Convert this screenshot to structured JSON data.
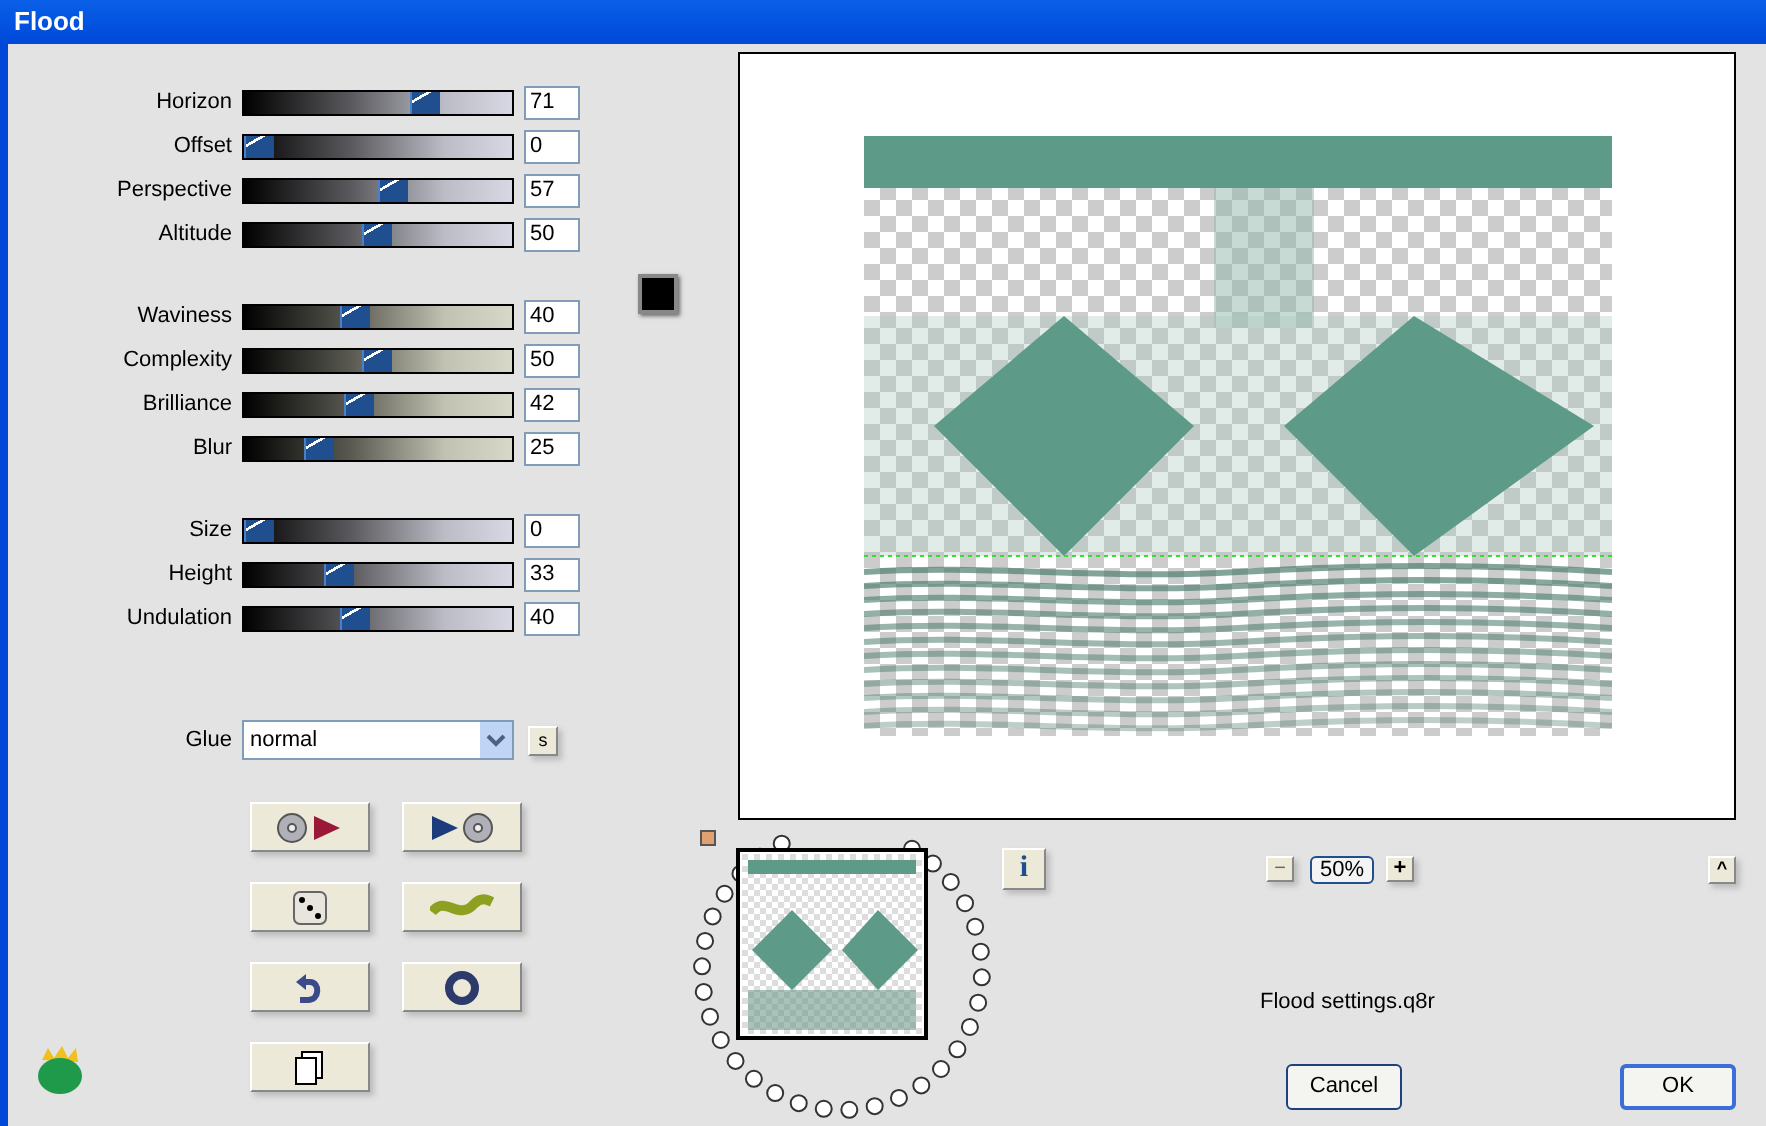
{
  "window": {
    "title": "Flood"
  },
  "slider_groups": [
    {
      "kind": "gray",
      "sliders": [
        {
          "label": "Horizon",
          "value": "71",
          "level": 0.69
        },
        {
          "label": "Offset",
          "value": "0",
          "level": 0
        },
        {
          "label": "Perspective",
          "value": "57",
          "level": 0.56
        },
        {
          "label": "Altitude",
          "value": "50",
          "level": 0.49
        }
      ]
    },
    {
      "kind": "tan",
      "sliders": [
        {
          "label": "Waviness",
          "value": "40",
          "level": 0.4
        },
        {
          "label": "Complexity",
          "value": "50",
          "level": 0.49
        },
        {
          "label": "Brilliance",
          "value": "42",
          "level": 0.42
        },
        {
          "label": "Blur",
          "value": "25",
          "level": 0.25
        }
      ]
    },
    {
      "kind": "gray",
      "sliders": [
        {
          "label": "Size",
          "value": "0",
          "level": 0
        },
        {
          "label": "Height",
          "value": "33",
          "level": 0.33
        },
        {
          "label": "Undulation",
          "value": "40",
          "level": 0.4
        }
      ]
    }
  ],
  "color_swatch": {
    "color": "#000000"
  },
  "glue": {
    "label": "Glue",
    "value": "normal",
    "button": "s"
  },
  "tool_buttons": [
    {
      "kind": "load"
    },
    {
      "kind": "save"
    },
    {
      "kind": "random"
    },
    {
      "kind": "wave"
    },
    {
      "kind": "undo"
    },
    {
      "kind": "ring"
    },
    {
      "kind": "copy"
    }
  ],
  "info_button": "i",
  "zoom": {
    "minus": "−",
    "value": "50%",
    "plus": "+"
  },
  "collapse_button": "^",
  "settings_file": "Flood settings.q8r",
  "buttons": [
    {
      "label": "Cancel",
      "default": false
    },
    {
      "label": "OK",
      "default": true
    }
  ]
}
